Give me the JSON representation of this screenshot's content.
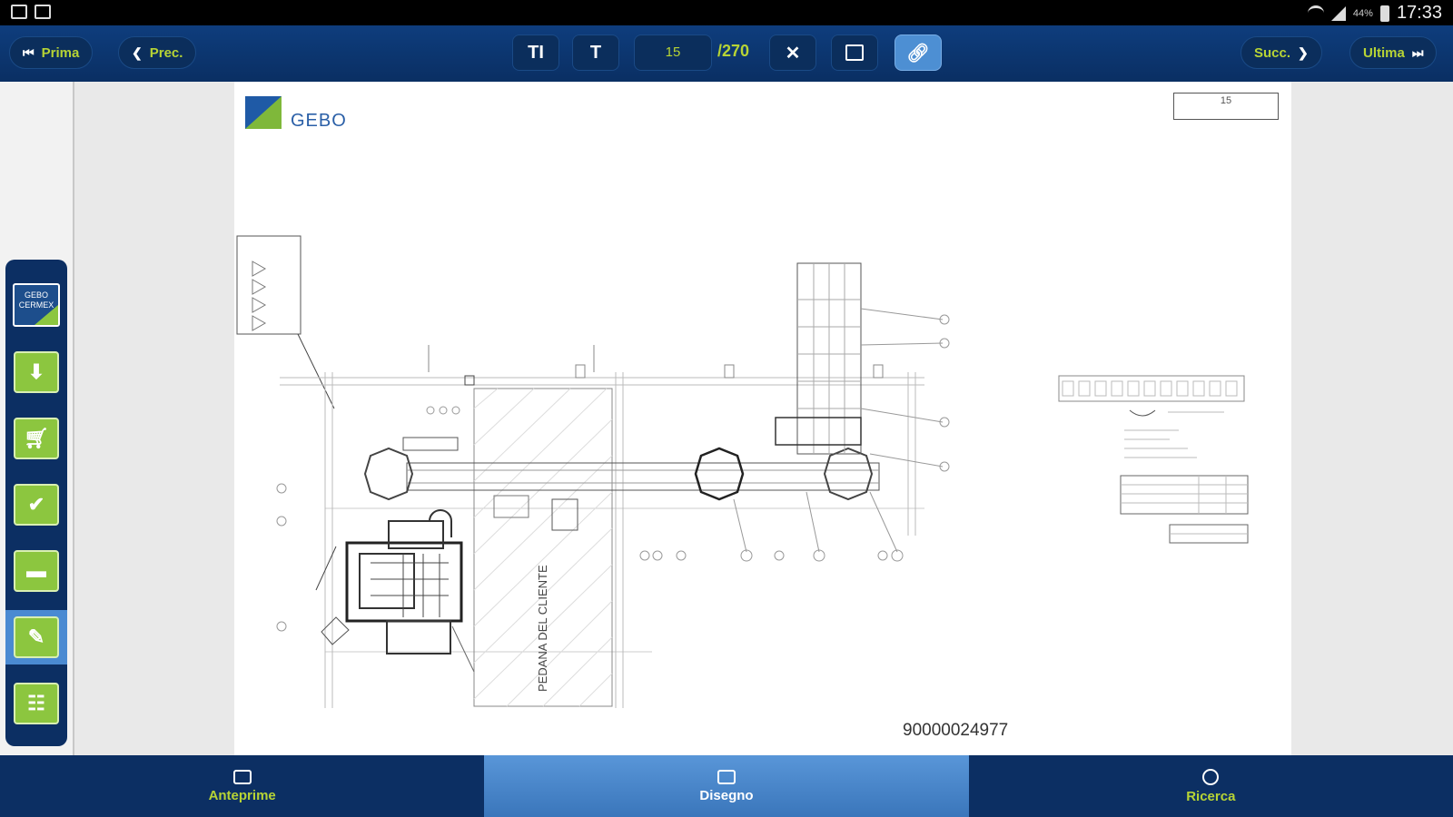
{
  "status_bar": {
    "time": "17:33",
    "battery": "44%"
  },
  "toolbar": {
    "first_label": "Prima",
    "prev_label": "Prec.",
    "next_label": "Succ.",
    "last_label": "Ultima",
    "text_size_label": "TI",
    "text_fit_label": "T",
    "current_page": "15",
    "total_pages": "/270",
    "link_active": true
  },
  "sidebar": {
    "logo_text": "GEBO CERMEX",
    "items": [
      {
        "icon": "gebo-cermex-logo-icon"
      },
      {
        "icon": "download-icon"
      },
      {
        "icon": "cart-icon"
      },
      {
        "icon": "checklist-icon"
      },
      {
        "icon": "folder-icon"
      },
      {
        "icon": "drawing-icon",
        "selected": true
      },
      {
        "icon": "parts-list-icon"
      }
    ]
  },
  "document": {
    "brand": "GEBO",
    "page_box": "15",
    "drawing_label": "PEDANA DEL CLIENTE",
    "document_number": "90000024977"
  },
  "tabs": [
    {
      "label": "Anteprime",
      "icon": "thumbnails-icon",
      "selected": false
    },
    {
      "label": "Disegno",
      "icon": "image-icon",
      "selected": true
    },
    {
      "label": "Ricerca",
      "icon": "search-icon",
      "selected": false
    }
  ],
  "colors": {
    "primary": "#0c2f63",
    "accent": "#b7d435",
    "selected": "#4a8ad2",
    "green": "#8cc63f"
  }
}
